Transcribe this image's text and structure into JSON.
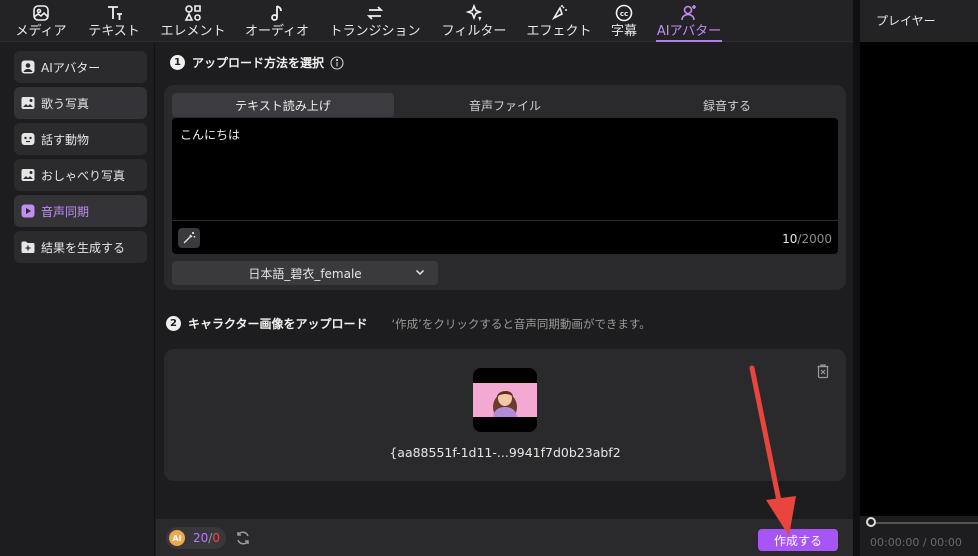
{
  "toolbar": {
    "items": [
      {
        "label": "メディア",
        "icon": "media-icon"
      },
      {
        "label": "テキスト",
        "icon": "text-icon"
      },
      {
        "label": "エレメント",
        "icon": "element-icon"
      },
      {
        "label": "オーディオ",
        "icon": "audio-icon"
      },
      {
        "label": "トランジション",
        "icon": "transition-icon"
      },
      {
        "label": "フィルター",
        "icon": "filter-icon"
      },
      {
        "label": "エフェクト",
        "icon": "effect-icon"
      },
      {
        "label": "字幕",
        "icon": "subtitle-icon"
      },
      {
        "label": "AIアバター",
        "icon": "ai-avatar-icon",
        "active": true
      }
    ]
  },
  "sidebar": {
    "items": [
      {
        "label": "AIアバター"
      },
      {
        "label": "歌う写真"
      },
      {
        "label": "話す動物"
      },
      {
        "label": "おしゃべり写真"
      },
      {
        "label": "音声同期",
        "active": true
      },
      {
        "label": "結果を生成する"
      }
    ]
  },
  "step1": {
    "number": "1",
    "title": "アップロード方法を選択",
    "tabs": [
      "テキスト読み上げ",
      "音声ファイル",
      "録音する"
    ],
    "active_tab": 0,
    "text_value": "こんにちは",
    "count_current": "10",
    "count_max": "/2000",
    "voice": "日本語_碧衣_female"
  },
  "step2": {
    "number": "2",
    "title": "キャラクター画像をアップロード",
    "hint": "‘作成’をクリックすると音声同期動画ができます。",
    "filename": "{aa88551f-1d11-...9941f7d0b23abf2"
  },
  "footer": {
    "coin_label": "AI",
    "credits_used": "20",
    "credits_sep": "/",
    "credits_left": "0",
    "create_label": "作成する"
  },
  "player": {
    "title": "プレイヤー",
    "time_current": "00:00:00",
    "time_sep": "/",
    "time_total": "00:00"
  },
  "colors": {
    "accent": "#a855f7",
    "accent_text": "#c38cf5",
    "panel": "#2a2a2d",
    "background": "#1d1d1f",
    "annotation_arrow": "#e8453c"
  }
}
